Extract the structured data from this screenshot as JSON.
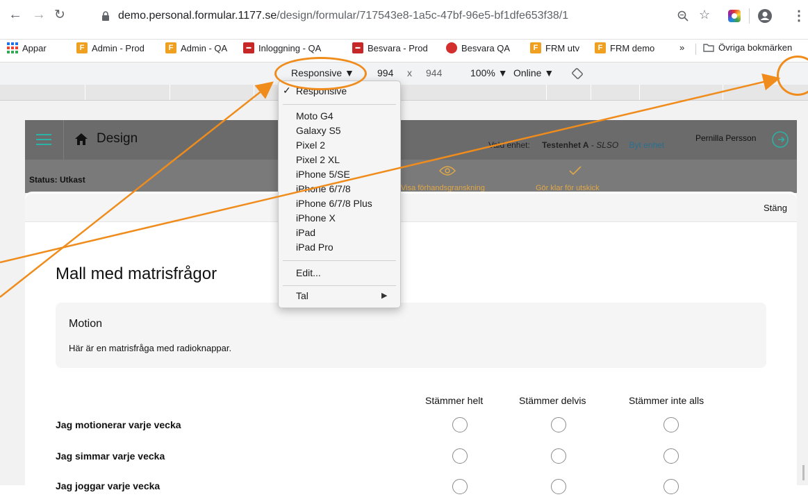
{
  "browser": {
    "url_host": "demo.personal.formular.1177.se",
    "url_path": "/design/formular/717543e8-1a5c-47bf-96e5-bf1dfe653f38/1"
  },
  "bookmarks": [
    {
      "label": "Appar",
      "icon": "apps-grid-icon"
    },
    {
      "label": "Admin - Prod",
      "icon": "f-favicon-icon"
    },
    {
      "label": "Admin - QA",
      "icon": "f-favicon-icon"
    },
    {
      "label": "Inloggning - QA",
      "icon": "bank-favicon-icon"
    },
    {
      "label": "Besvara - Prod",
      "icon": "bank-favicon-icon"
    },
    {
      "label": "Besvara QA",
      "icon": "red-circle-favicon-icon"
    },
    {
      "label": "FRM utv",
      "icon": "f-favicon-icon"
    },
    {
      "label": "FRM demo",
      "icon": "f-favicon-icon"
    },
    {
      "label": "»",
      "icon": ""
    },
    {
      "label": "Övriga bokmärken",
      "icon": "folder-icon"
    }
  ],
  "device_toolbar": {
    "device": "Responsive ▼",
    "width": "994",
    "times": "x",
    "height": "944",
    "zoom": "100% ▼",
    "network": "Online ▼"
  },
  "app": {
    "title": "Design",
    "unit_label": "Vald enhet:",
    "unit_name": "Testenhet A",
    "unit_sep": " - ",
    "unit_code": "SLSO",
    "change_unit": "Byt enhet",
    "user": "Pernilla Persson",
    "status": "Status: Utkast",
    "preview": "Visa förhandsgranskning",
    "ready": "Gör klar för utskick",
    "close": "Stäng"
  },
  "form": {
    "title": "Mall med matrisfrågor",
    "section_title": "Motion",
    "section_desc": "Här är en matrisfråga med radioknappar.",
    "columns": [
      "Stämmer helt",
      "Stämmer delvis",
      "Stämmer inte alls"
    ],
    "rows": [
      "Jag motionerar varje vecka",
      "Jag simmar varje vecka",
      "Jag joggar varje vecka"
    ]
  },
  "device_menu": {
    "checked": "✓",
    "responsive": "Responsive",
    "devices": [
      "Moto G4",
      "Galaxy S5",
      "Pixel 2",
      "Pixel 2 XL",
      "iPhone 5/SE",
      "iPhone 6/7/8",
      "iPhone 6/7/8 Plus",
      "iPhone X",
      "iPad",
      "iPad Pro"
    ],
    "edit": "Edit...",
    "tal": "Tal",
    "tal_arrow": "▶"
  },
  "colors": {
    "annotation": "#ef8c1c",
    "appbar": "#6b6b6b",
    "accent_teal": "#2ab3a6"
  }
}
